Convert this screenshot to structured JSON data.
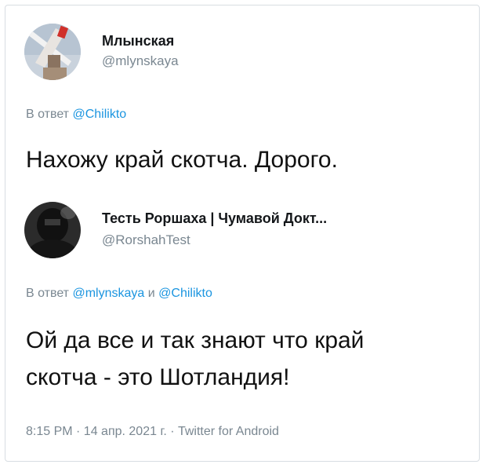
{
  "tweet1": {
    "name": "Млынская",
    "handle": "@mlynskaya",
    "reply_prefix": "В ответ",
    "reply_mention": "@Chilikto",
    "text": "Нахожу край скотча. Дорого."
  },
  "tweet2": {
    "name": "Тесть Роршаха | Чумавой Докт...",
    "handle": "@RorshahTest",
    "reply_prefix": "В ответ",
    "reply_mention1": "@mlynskaya",
    "reply_joiner": "и",
    "reply_mention2": "@Chilikto",
    "text_line1": "Ой да все и так знают что край",
    "text_line2": "скотча - это Шотландия!",
    "timestamp": "8:15 PM · 14 апр. 2021 г. · Twitter for Android"
  },
  "colors": {
    "link": "#1b95e0",
    "secondary_text": "#7a8791"
  },
  "icons": [
    "windmill-avatar",
    "hooded-figure-avatar"
  ]
}
